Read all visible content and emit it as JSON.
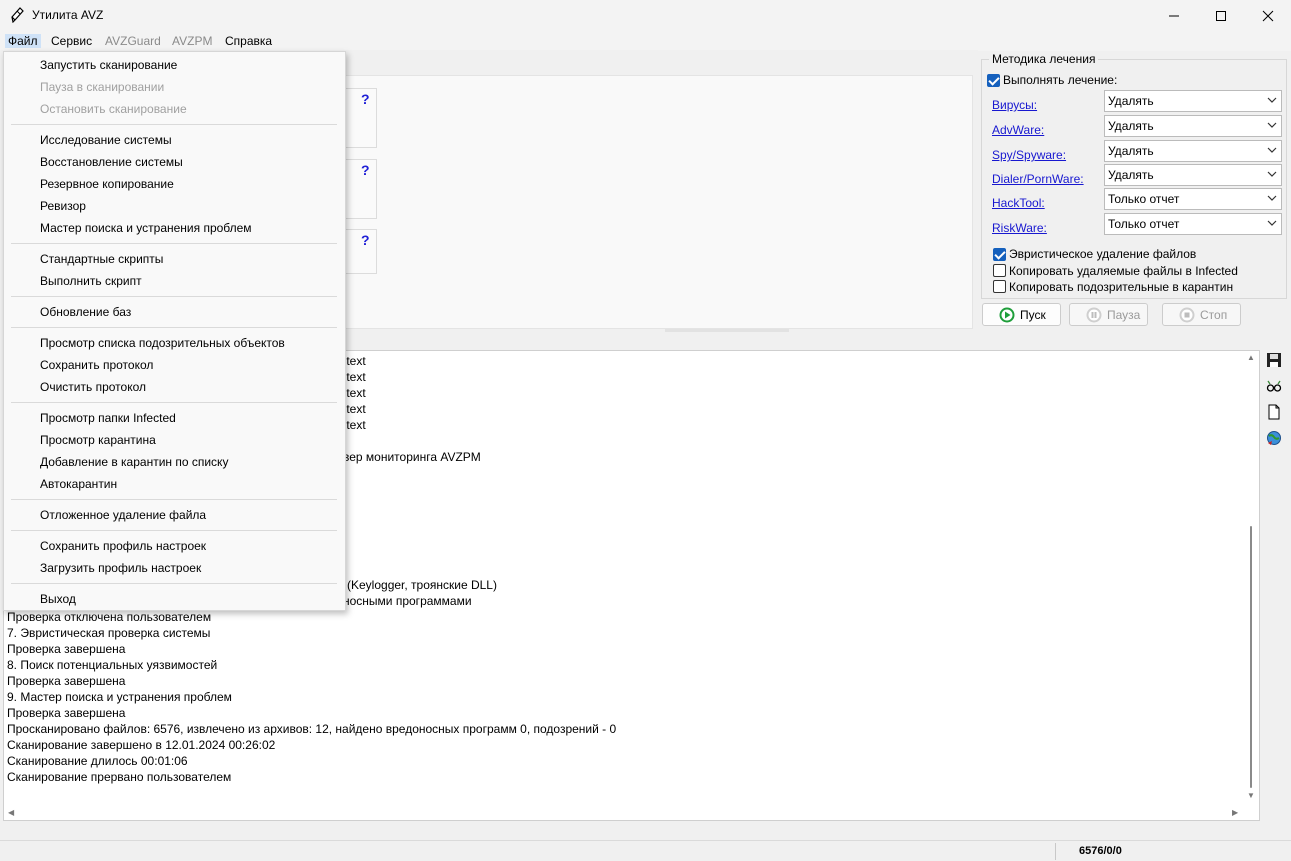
{
  "window": {
    "title": "Утилита AVZ",
    "icon": "avz-pen-icon"
  },
  "menubar": {
    "items": [
      {
        "label": "Файл",
        "state": "active"
      },
      {
        "label": "Сервис",
        "state": "normal"
      },
      {
        "label": "AVZGuard",
        "state": "disabled"
      },
      {
        "label": "AVZPM",
        "state": "disabled"
      },
      {
        "label": "Справка",
        "state": "normal"
      }
    ]
  },
  "file_menu": {
    "groups": [
      [
        {
          "label": "Запустить сканирование",
          "enabled": true
        },
        {
          "label": "Пауза в сканировании",
          "enabled": false
        },
        {
          "label": "Остановить сканирование",
          "enabled": false
        }
      ],
      [
        {
          "label": "Исследование системы",
          "enabled": true
        },
        {
          "label": "Восстановление системы",
          "enabled": true
        },
        {
          "label": "Резервное копирование",
          "enabled": true
        },
        {
          "label": "Ревизор",
          "enabled": true
        },
        {
          "label": "Мастер поиска и устранения проблем",
          "enabled": true
        }
      ],
      [
        {
          "label": "Стандартные скрипты",
          "enabled": true
        },
        {
          "label": "Выполнить скрипт",
          "enabled": true
        }
      ],
      [
        {
          "label": "Обновление баз",
          "enabled": true
        }
      ],
      [
        {
          "label": "Просмотр списка подозрительных объектов",
          "enabled": true
        },
        {
          "label": "Сохранить протокол",
          "enabled": true
        },
        {
          "label": "Очистить протокол",
          "enabled": true
        }
      ],
      [
        {
          "label": "Просмотр папки Infected",
          "enabled": true
        },
        {
          "label": "Просмотр карантина",
          "enabled": true
        },
        {
          "label": "Добавление в карантин по списку",
          "enabled": true
        },
        {
          "label": "Автокарантин",
          "enabled": true
        }
      ],
      [
        {
          "label": "Отложенное удаление файла",
          "enabled": true
        }
      ],
      [
        {
          "label": "Сохранить профиль настроек",
          "enabled": true
        },
        {
          "label": "Загрузить профиль настроек",
          "enabled": true
        }
      ],
      [
        {
          "label": "Выход",
          "enabled": true
        }
      ]
    ]
  },
  "help_marks": [
    "?",
    "?",
    "?"
  ],
  "treatment": {
    "group_title": "Методика лечения",
    "perform_label": "Выполнять лечение:",
    "perform_checked": true,
    "rows": [
      {
        "label": "Вирусы:",
        "value": "Удалять"
      },
      {
        "label": "AdvWare:",
        "value": "Удалять"
      },
      {
        "label": "Spy/Spyware:",
        "value": "Удалять"
      },
      {
        "label": "Dialer/PornWare:",
        "value": "Удалять"
      },
      {
        "label": "HackTool:",
        "value": "Только отчет"
      },
      {
        "label": "RiskWare:",
        "value": "Только отчет"
      }
    ],
    "options": [
      {
        "label": "Эвристическое удаление файлов",
        "checked": true
      },
      {
        "label": "Копировать удаляемые файлы в  Infected",
        "checked": false
      },
      {
        "label": "Копировать подозрительные в  карантин",
        "checked": false
      }
    ]
  },
  "buttons": {
    "start": "Пуск",
    "pause": "Пауза",
    "stop": "Стоп"
  },
  "colors": {
    "start_icon": "#1e9e3a",
    "link": "#1818d0",
    "check_on": "#1560bd"
  },
  "log": {
    "partial_lines": [
      ".text",
      ".text",
      ".text",
      ".text",
      ".text",
      "вер мониторинга AVZPM",
      "(Keylogger, троянские DLL)",
      "носными программами"
    ],
    "lines": [
      " Проверка отключена пользователем",
      "7. Эвристическая проверка системы",
      "Проверка завершена",
      "8. Поиск потенциальных уязвимостей",
      "Проверка завершена",
      "9. Мастер поиска и устранения проблем",
      "Проверка завершена",
      "Просканировано файлов: 6576, извлечено из архивов: 12, найдено вредоносных программ 0, подозрений - 0",
      "Сканирование завершено в 12.01.2024 00:26:02",
      "Сканирование длилось 00:01:06",
      "Сканирование прервано пользователем"
    ]
  },
  "status": {
    "counter": "6576/0/0"
  }
}
